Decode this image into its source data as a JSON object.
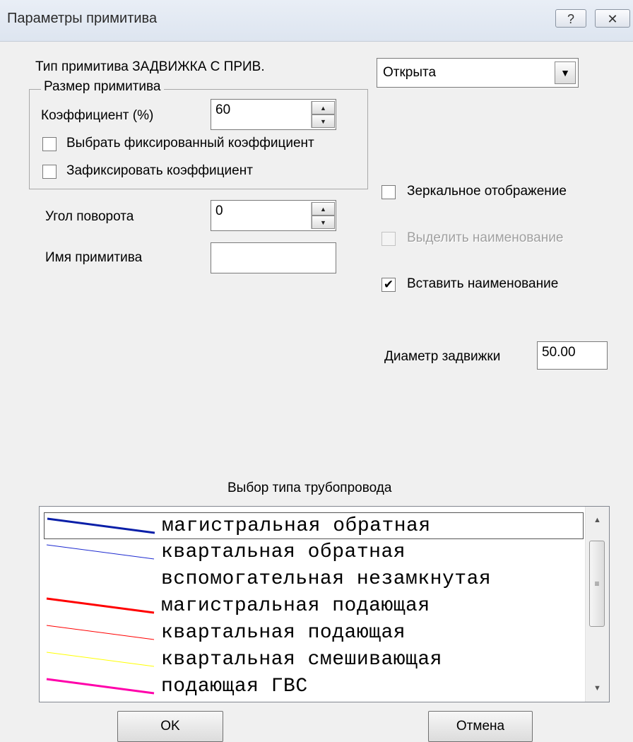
{
  "window": {
    "title": "Параметры примитива",
    "help_label": "?",
    "close_label": "✕"
  },
  "primitive_type_label": "Тип примитива ЗАДВИЖКА С ПРИВ.",
  "size_group": {
    "legend": "Размер примитива",
    "coef_label": "Коэффициент (%)",
    "coef_value": "60",
    "fixed_choice_label": "Выбрать фиксированный коэффициент",
    "fixed_choice_checked": false,
    "fix_label": "Зафиксировать коэффициент",
    "fix_checked": false
  },
  "rotation": {
    "label": "Угол поворота",
    "value": "0"
  },
  "name": {
    "label": "Имя примитива",
    "value": ""
  },
  "state_select": {
    "value": "Открыта"
  },
  "options": {
    "mirror_label": "Зеркальное отображение",
    "mirror_checked": false,
    "highlight_label": "Выделить наименование",
    "highlight_checked": false,
    "highlight_disabled": true,
    "insert_label": "Вставить наименование",
    "insert_checked": true
  },
  "diameter": {
    "label": "Диаметр задвижки",
    "value": "50.00"
  },
  "pipeline": {
    "title": "Выбор типа трубопровода",
    "items": [
      {
        "label": "магистральная обратная",
        "color": "#0a1fa8",
        "width": 3,
        "selected": true
      },
      {
        "label": "квартальная обратная",
        "color": "#1d2ad0",
        "width": 1,
        "selected": false
      },
      {
        "label": "вспомогательная незамкнутая",
        "color": "#ffffff",
        "width": 1,
        "selected": false
      },
      {
        "label": "магистральная подающая",
        "color": "#ff0000",
        "width": 3,
        "selected": false
      },
      {
        "label": "квартальная подающая",
        "color": "#ff0000",
        "width": 1,
        "selected": false
      },
      {
        "label": "квартальная смешивающая",
        "color": "#ffff00",
        "width": 1,
        "selected": false
      },
      {
        "label": "подающая ГВС",
        "color": "#ff00aa",
        "width": 3,
        "selected": false
      }
    ]
  },
  "buttons": {
    "ok": "OK",
    "cancel": "Отмена"
  }
}
